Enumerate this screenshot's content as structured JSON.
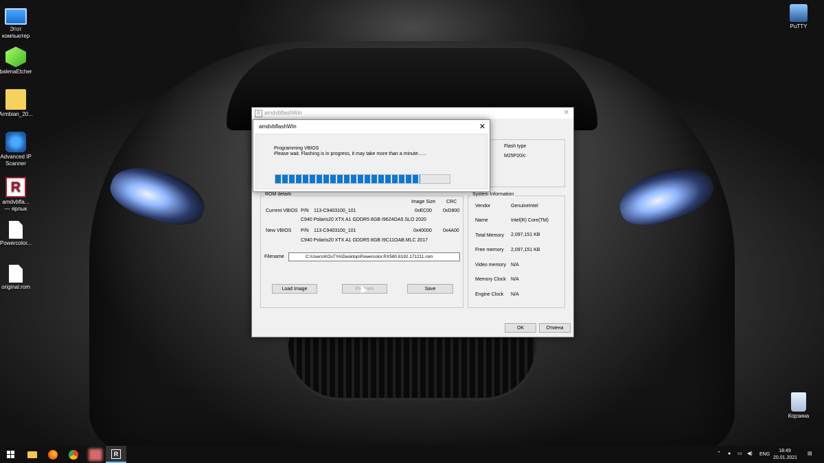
{
  "desktop": {
    "icons_left": [
      {
        "label": "Этот\nкомпьютер",
        "icon": "computer-icon"
      },
      {
        "label": "balenaEtcher",
        "icon": "etcher-icon"
      },
      {
        "label": "Armbian_20...",
        "icon": "archive-folder-icon"
      },
      {
        "label": "Advanced IP\nScanner",
        "icon": "network-scanner-icon"
      },
      {
        "label": "amdvbfla...\n— ярлык",
        "icon": "amdvbflash-icon"
      },
      {
        "label": "Powercolor...",
        "icon": "file-icon"
      },
      {
        "label": "original.rom",
        "icon": "file-icon"
      }
    ],
    "icons_right": [
      {
        "label": "PuTTY",
        "icon": "putty-icon"
      },
      {
        "label": "Корзина",
        "icon": "recycle-bin-icon"
      }
    ]
  },
  "main_window": {
    "title": "amdvbflashWin",
    "flash_type_label": "Flash type",
    "flash_type_value": "M25P20/c",
    "rom_details": {
      "legend": "ROM details",
      "col_image_size": "Image Size",
      "col_crc": "CRC",
      "current_label": "Current VBIOS",
      "current_pn_label": "P/N",
      "current_pn": "113-C9403100_101",
      "current_size": "0xEC00",
      "current_crc": "0xD800",
      "current_desc": "C940 Polaris20 XTX A1 GDDR5 8GB I9624OA5.SLO 2020",
      "new_label": "New VBIOS",
      "new_pn_label": "P/N",
      "new_pn": "113-C9403100_101",
      "new_size": "0x40000",
      "new_crc": "0x4A00",
      "new_desc": "C940 Polaris20 XTX A1 GDDR5 8GB I9C11OAB.MLC 2017",
      "filename_label": "Filename",
      "filename_value": "C:\\Users\\KOsTYA\\Desktop\\Powercolor.RX580.8192.171211.rom"
    },
    "buttons": {
      "load_image": "Load Image",
      "program": "Program",
      "save": "Save",
      "ok": "OK",
      "cancel": "Отмена"
    },
    "system_info": {
      "legend": "System Information",
      "rows": [
        {
          "label": "Vendor",
          "value": "GenuineIntel"
        },
        {
          "label": "Name",
          "value": "Intel(R) Core(TM)"
        },
        {
          "label": "Total Memory",
          "value": "2,097,151 KB"
        },
        {
          "label": "Free memory",
          "value": "2,097,151 KB"
        },
        {
          "label": "Video memory",
          "value": "N/A"
        },
        {
          "label": "Memory Clock",
          "value": "N/A"
        },
        {
          "label": "Engine Clock",
          "value": "N/A"
        }
      ]
    }
  },
  "dialog": {
    "title": "amdvbflashWin",
    "heading": "Programming VBIOS",
    "message": "Please wait.  Flashing is in progress, it may take more than a minute......",
    "progress_fraction": 0.83
  },
  "taskbar": {
    "lang": "ENG",
    "time": "18:49",
    "date": "20.01.2021"
  }
}
